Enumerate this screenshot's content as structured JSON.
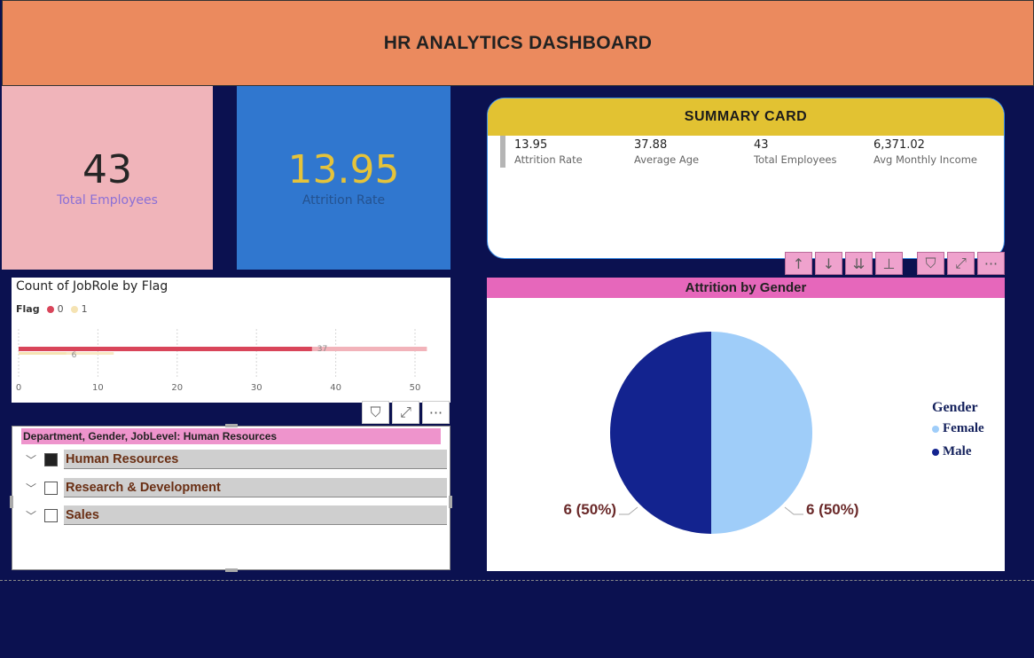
{
  "header": {
    "title": "HR ANALYTICS DASHBOARD"
  },
  "kpis": {
    "total_employees": {
      "value": "43",
      "label": "Total Employees"
    },
    "attrition_rate": {
      "value": "13.95",
      "label": "Attrition Rate"
    }
  },
  "summary_card": {
    "title": "SUMMARY CARD",
    "metrics": [
      {
        "value": "13.95",
        "label": "Attrition Rate"
      },
      {
        "value": "37.88",
        "label": "Average Age"
      },
      {
        "value": "43",
        "label": "Total Employees"
      },
      {
        "value": "6,371.02",
        "label": "Avg Monthly Income"
      }
    ]
  },
  "visual_toolbar": {
    "icons": [
      "drill-up-icon",
      "drill-down-icon",
      "expand-next-level-icon",
      "expand-hierarchy-icon",
      "filter-icon",
      "focus-mode-icon",
      "more-options-icon"
    ],
    "glyphs": [
      "↑",
      "↓",
      "⇊",
      "⊥",
      "⛉",
      "⤢",
      "···"
    ]
  },
  "bar_chart_toolbar": {
    "icons": [
      "filter-icon",
      "focus-mode-icon",
      "more-options-icon"
    ],
    "glyphs": [
      "⛉",
      "⤢",
      "···"
    ]
  },
  "bar_chart": {
    "title": "Count of JobRole by Flag",
    "legend_title": "Flag",
    "legend": [
      {
        "label": "0",
        "color": "#d9455a"
      },
      {
        "label": "1",
        "color": "#f5e3b3"
      }
    ]
  },
  "slicer": {
    "header": "Department, Gender, JobLevel: Human Resources",
    "items": [
      {
        "label": "Human Resources",
        "checked": true
      },
      {
        "label": "Research & Development",
        "checked": false
      },
      {
        "label": "Sales",
        "checked": false
      }
    ]
  },
  "pie_chart_card": {
    "title": "Attrition by Gender",
    "legend_title": "Gender",
    "legend": [
      {
        "label": "Female",
        "color": "#9fcdf9"
      },
      {
        "label": "Male",
        "color": "#13238f"
      }
    ]
  },
  "chart_data": [
    {
      "type": "bar",
      "orientation": "horizontal",
      "title": "Count of JobRole by Flag",
      "legend_title": "Flag",
      "series": [
        {
          "name": "0",
          "values": [
            37
          ],
          "color": "#d9455a"
        },
        {
          "name": "1",
          "values": [
            6
          ],
          "color": "#f5e3b3"
        }
      ],
      "xlim": [
        0,
        50
      ],
      "xticks": [
        0,
        10,
        20,
        30,
        40,
        50
      ],
      "data_labels": [
        "37",
        "6"
      ],
      "grid": true,
      "legend_position": "top-left"
    },
    {
      "type": "pie",
      "title": "Attrition by Gender",
      "legend_title": "Gender",
      "slices": [
        {
          "label": "Female",
          "value": 6,
          "percent": 50,
          "color": "#9fcdf9",
          "data_label": "6 (50%)"
        },
        {
          "label": "Male",
          "value": 6,
          "percent": 50,
          "color": "#13238f",
          "data_label": "6 (50%)"
        }
      ],
      "legend_position": "right"
    }
  ]
}
